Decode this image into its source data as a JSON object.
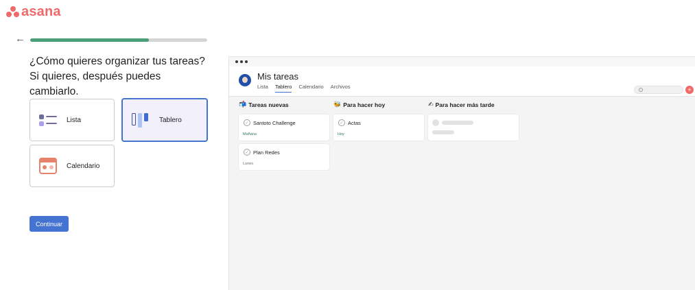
{
  "logo": {
    "text": "asana"
  },
  "progress": {
    "value": 0.67
  },
  "question": {
    "text": "¿Cómo quieres organizar tus tareas? Si quieres, después puedes cambiarlo."
  },
  "options": [
    {
      "label": "Lista",
      "icon": "list-icon",
      "selected": false
    },
    {
      "label": "Tablero",
      "icon": "board-icon",
      "selected": true
    },
    {
      "label": "Calendario",
      "icon": "calendar-icon",
      "selected": false
    }
  ],
  "continue_label": "Continuar",
  "preview": {
    "title": "Mis tareas",
    "tabs": [
      "Lista",
      "Tablero",
      "Calendario",
      "Archivos"
    ],
    "active_tab": "Tablero",
    "columns": [
      {
        "emoji": "📬",
        "title": "Tareas nuevas",
        "tasks": [
          {
            "name": "Santoto Challenge",
            "due": "Mañana",
            "due_color": "#2a7a5a"
          },
          {
            "name": "Plan Redes",
            "due": "Lunes",
            "due_color": "#6d6e6f"
          }
        ]
      },
      {
        "emoji": "🐝",
        "title": "Para hacer hoy",
        "tasks": [
          {
            "name": "Actas",
            "due": "Hoy",
            "due_color": "#2a7a5a"
          }
        ]
      },
      {
        "emoji": "✍",
        "title": "Para hacer más tarde",
        "tasks": []
      }
    ]
  },
  "colors": {
    "brand": "#f06a6a",
    "accent": "#4573d2",
    "progress": "#4b9e78"
  }
}
